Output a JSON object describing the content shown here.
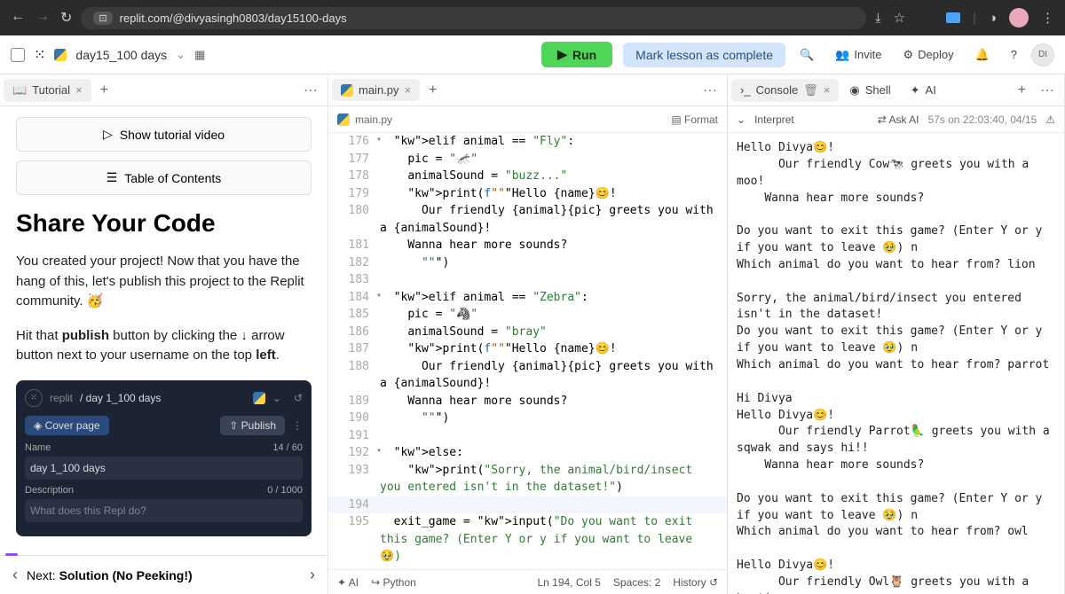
{
  "browser": {
    "url": "replit.com/@divyasingh0803/day15100-days"
  },
  "topbar": {
    "project_name": "day15_100 days",
    "run_label": "Run",
    "complete_label": "Mark lesson as complete",
    "invite_label": "Invite",
    "deploy_label": "Deploy",
    "avatar_initials": "DI"
  },
  "tutorial": {
    "tab_label": "Tutorial",
    "show_video": "Show tutorial video",
    "toc": "Table of Contents",
    "h1": "Share Your Code",
    "p1_prefix": "You created your project! Now that you have the hang of this, let's publish this project to the Replit community. ",
    "p1_emoji": "🥳",
    "p2_a": "Hit that ",
    "p2_b": "publish",
    "p2_c": " button by clicking the  ↓  arrow button next to your username on the top ",
    "p2_d": "left",
    "p2_e": ".",
    "embed": {
      "brand": "replit",
      "path": "/  day 1_100 days",
      "cover": "Cover page",
      "publish": "Publish",
      "name_label": "Name",
      "name_count": "14 / 60",
      "name_value": "day 1_100 days",
      "desc_label": "Description",
      "desc_count": "0 / 1000",
      "desc_placeholder": "What does this Repl do?"
    },
    "next_prefix": "Next: ",
    "next_title": "Solution (No Peeking!)"
  },
  "editor": {
    "tab_label": "main.py",
    "breadcrumb": "main.py",
    "format_label": "Format",
    "lines": [
      {
        "n": 176,
        "fold": true,
        "txt": "  elif animal == \"Fly\":",
        "cls": [
          "kw",
          "",
          "op",
          "",
          "str"
        ]
      },
      {
        "n": 177,
        "txt": "    pic = \"🦟\""
      },
      {
        "n": 178,
        "txt": "    animalSound = \"buzz...\""
      },
      {
        "n": 179,
        "txt": "    print(f\"\"\"Hello {name}😊!"
      },
      {
        "n": 180,
        "txt": "      Our friendly {animal}{pic} greets you with a {animalSound}!"
      },
      {
        "n": 181,
        "txt": "    Wanna hear more sounds?"
      },
      {
        "n": 182,
        "txt": "      \"\"\")"
      },
      {
        "n": 183,
        "txt": ""
      },
      {
        "n": 184,
        "fold": true,
        "txt": "  elif animal == \"Zebra\":"
      },
      {
        "n": 185,
        "txt": "    pic = \"🦓\""
      },
      {
        "n": 186,
        "txt": "    animalSound = \"bray\""
      },
      {
        "n": 187,
        "txt": "    print(f\"\"\"Hello {name}😊!"
      },
      {
        "n": 188,
        "txt": "      Our friendly {animal}{pic} greets you with a {animalSound}!"
      },
      {
        "n": 189,
        "txt": "    Wanna hear more sounds?"
      },
      {
        "n": 190,
        "txt": "      \"\"\")"
      },
      {
        "n": 191,
        "txt": ""
      },
      {
        "n": 192,
        "fold": true,
        "txt": "  else:"
      },
      {
        "n": 193,
        "txt": "    print(\"Sorry, the animal/bird/insect you entered isn't in the dataset!\")"
      },
      {
        "n": 194,
        "hl": true,
        "txt": "    "
      },
      {
        "n": 195,
        "txt": "  exit_game = input(\"Do you want to exit this game? (Enter Y or y if you want to leave 🥹)"
      }
    ],
    "status": {
      "ai": "AI",
      "lang": "Python",
      "pos": "Ln 194, Col 5",
      "spaces": "Spaces: 2",
      "history": "History"
    }
  },
  "console": {
    "tabs": {
      "console": "Console",
      "shell": "Shell",
      "ai": "AI"
    },
    "interpret": "Interpret",
    "ask_ai": "Ask AI",
    "timestamp": "57s on 22:03:40, 04/15",
    "output": "Hello Divya😊!\n      Our friendly Cow🐄 greets you with a moo!\n    Wanna hear more sounds?\n      \nDo you want to exit this game? (Enter Y or y if you want to leave 🥹) n\nWhich animal do you want to hear from? lion\n\nSorry, the animal/bird/insect you entered isn't in the dataset!\nDo you want to exit this game? (Enter Y or y if you want to leave 🥹) n\nWhich animal do you want to hear from? parrot\n\nHi Divya\nHello Divya😊!\n      Our friendly Parrot🦜 greets you with a sqwak and says hi!!\n    Wanna hear more sounds?\n      \nDo you want to exit this game? (Enter Y or y if you want to leave 🥹) n\nWhich animal do you want to hear from? owl\n\nHello Divya😊!\n      Our friendly Owl🦉 greets you with a hoot!\n    Wanna hear more sounds?\n      \nDo you want to exit this game? (Enter Y or y if you want to leave 🥹)"
  }
}
